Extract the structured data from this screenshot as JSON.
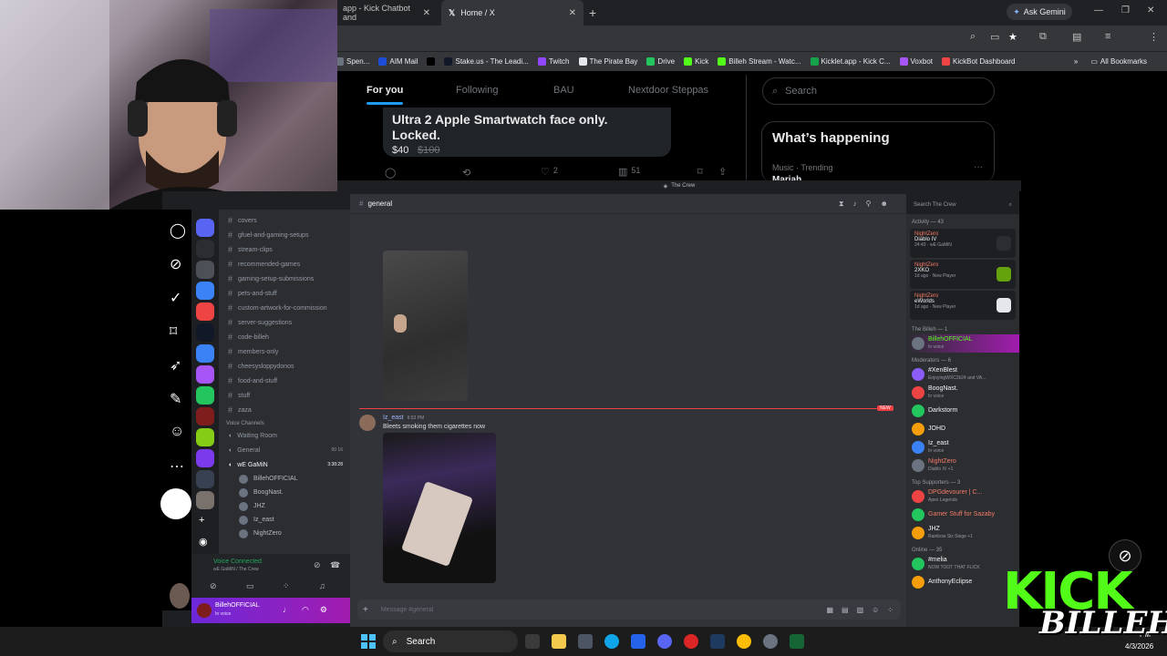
{
  "browser": {
    "tabs": [
      {
        "label": "app - Kick Chatbot and"
      },
      {
        "label": "Home / X"
      }
    ],
    "gemini_label": "Ask Gemini",
    "bookmarks": [
      {
        "label": "Spen...",
        "color": "#6b7280"
      },
      {
        "label": "AIM Mail",
        "color": "#1d4ed8"
      },
      {
        "label": "",
        "color": "#000000"
      },
      {
        "label": "Stake.us - The Leadi...",
        "color": "#111827"
      },
      {
        "label": "Twitch",
        "color": "#9146ff"
      },
      {
        "label": "The Pirate Bay",
        "color": "#e5e7eb"
      },
      {
        "label": "Drive",
        "color": "#22c55e"
      },
      {
        "label": "Kick",
        "color": "#53fc18"
      },
      {
        "label": "Billeh Stream - Watc...",
        "color": "#53fc18"
      },
      {
        "label": "Kicklet.app - Kick C...",
        "color": "#16a34a"
      },
      {
        "label": "Voxbot",
        "color": "#a855f7"
      },
      {
        "label": "KickBot Dashboard",
        "color": "#ef4444"
      }
    ],
    "all_bookmarks": "All Bookmarks"
  },
  "x": {
    "tabs": [
      "For you",
      "Following",
      "BAU",
      "Nextdoor Steppas"
    ],
    "search_placeholder": "Search",
    "tweet_title": "Ultra 2 Apple Smartwatch face only. Locked.",
    "price_new": "$40",
    "price_old": "$100",
    "likes": "2",
    "views": "51",
    "happening_title": "What’s happening",
    "trend_meta": "Music · Trending",
    "trend_name": "Mariah"
  },
  "discord": {
    "window_title": "The Crew",
    "channel_name": "general",
    "search_placeholder": "Search The Crew",
    "channels": [
      "covers",
      "gfuel-and-gaming-setups",
      "stream-clips",
      "recommended-games",
      "gaming-setup-submissions",
      "pets-and-stuff",
      "custom-artwork-for-commission",
      "server-suggestions",
      "code-billeh",
      "members-only",
      "cheesysloppydonos",
      "food-and-stuff",
      "stuff",
      "zaza"
    ],
    "voice_header": "Voice Channels",
    "voice_channels": [
      {
        "name": "Waiting Room",
        "meta": ""
      },
      {
        "name": "General",
        "meta": "00 16"
      },
      {
        "name": "wE GaMiN",
        "meta": "3:38:28"
      }
    ],
    "voice_users": [
      "BillehOFFICIAL",
      "BoogNast.",
      "JHZ",
      "Iz_east",
      "NightZero"
    ],
    "message": {
      "author": "Iz_east",
      "time": "6:53 PM",
      "text": "Bleets smoking them cigarettes now",
      "new_label": "NEW"
    },
    "message_placeholder": "Message #general",
    "voice_status": "Voice Connected",
    "voice_location": "wE GaMiN / The Crew",
    "user": {
      "name": "BillehOFFICIAL",
      "status": "In voice"
    },
    "activity_header": "Activity — 43",
    "activities": [
      {
        "user": "NightZero",
        "game": "Diablo IV",
        "meta": "24:43 · wE GaMiN"
      },
      {
        "user": "NightZero",
        "game": "2XKO",
        "meta": "1d ago · New Player"
      },
      {
        "user": "NightZero",
        "game": "eWorlds",
        "meta": "1d ago · New Player"
      }
    ],
    "member_groups": [
      {
        "title": "The Billeh — 1",
        "members": [
          {
            "name": "BillehOFFICIAL",
            "sub": "In voice",
            "color": "#53fc18"
          }
        ]
      },
      {
        "title": "Moderators — 6",
        "members": [
          {
            "name": "#XenBlest",
            "sub": "EnjoyingWXC2k24 and VA...",
            "color": "#f2f3f5"
          },
          {
            "name": "BoogNast.",
            "sub": "In voice",
            "color": "#f2f3f5"
          },
          {
            "name": "Darkstorm",
            "sub": "",
            "color": "#f2f3f5"
          },
          {
            "name": "JOHD",
            "sub": "",
            "color": "#f2f3f5"
          },
          {
            "name": "Iz_east",
            "sub": "In voice",
            "color": "#f2f3f5"
          },
          {
            "name": "NightZero",
            "sub": "Diablo IV +1",
            "color": "#f47b67"
          }
        ]
      },
      {
        "title": "Top Supporters — 3",
        "members": [
          {
            "name": "DPGdevourer | C...",
            "sub": "Apex Legends",
            "color": "#f47b67"
          },
          {
            "name": "Gamer Stuff for Sazaby",
            "sub": "",
            "color": "#f47b67"
          },
          {
            "name": "JHZ",
            "sub": "Rainbow Six Siege +1",
            "color": "#f2f3f5"
          }
        ]
      },
      {
        "title": "Online — 35",
        "members": [
          {
            "name": "#melia",
            "sub": "NOW TOOT THAT FLICK",
            "color": "#f2f3f5"
          },
          {
            "name": "AnthonyEclipse",
            "sub": "",
            "color": "#f2f3f5"
          }
        ]
      }
    ]
  },
  "taskbar": {
    "search": "Search",
    "time": "PM",
    "date": "4/3/2026"
  },
  "overlay": {
    "kick": "KICK",
    "name": "BILLEH"
  }
}
